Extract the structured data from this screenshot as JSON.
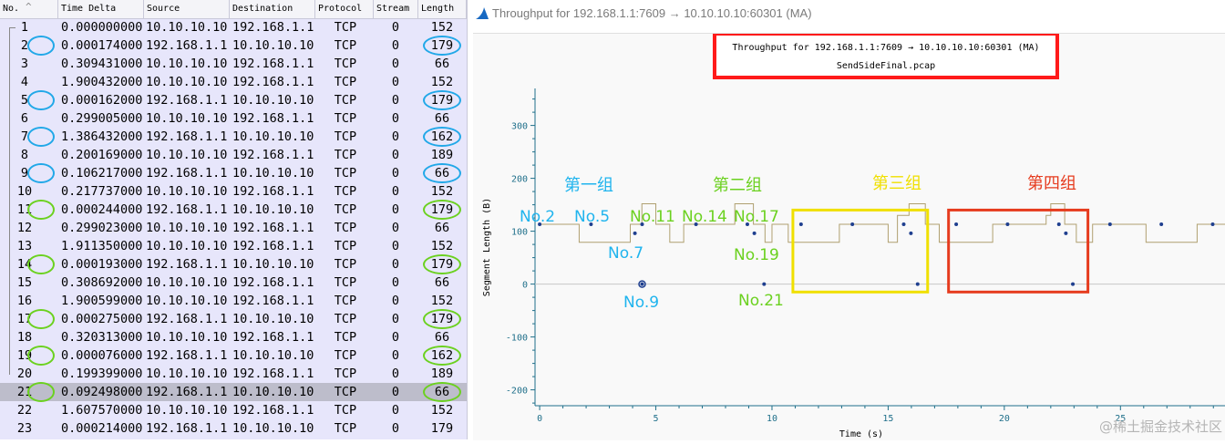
{
  "packet_list": {
    "columns": [
      "No.",
      "Time Delta",
      "Source",
      "Destination",
      "Protocol",
      "Stream",
      "Length"
    ],
    "rows": [
      {
        "no": "1",
        "time_delta": "0.000000000",
        "source": "10.10.10.10",
        "destination": "192.168.1.1",
        "protocol": "TCP",
        "stream": "0",
        "length": "152",
        "mark": ""
      },
      {
        "no": "2",
        "time_delta": "0.000174000",
        "source": "192.168.1.1",
        "destination": "10.10.10.10",
        "protocol": "TCP",
        "stream": "0",
        "length": "179",
        "mark": "blue"
      },
      {
        "no": "3",
        "time_delta": "0.309431000",
        "source": "10.10.10.10",
        "destination": "192.168.1.1",
        "protocol": "TCP",
        "stream": "0",
        "length": "66",
        "mark": ""
      },
      {
        "no": "4",
        "time_delta": "1.900432000",
        "source": "10.10.10.10",
        "destination": "192.168.1.1",
        "protocol": "TCP",
        "stream": "0",
        "length": "152",
        "mark": ""
      },
      {
        "no": "5",
        "time_delta": "0.000162000",
        "source": "192.168.1.1",
        "destination": "10.10.10.10",
        "protocol": "TCP",
        "stream": "0",
        "length": "179",
        "mark": "blue"
      },
      {
        "no": "6",
        "time_delta": "0.299005000",
        "source": "10.10.10.10",
        "destination": "192.168.1.1",
        "protocol": "TCP",
        "stream": "0",
        "length": "66",
        "mark": ""
      },
      {
        "no": "7",
        "time_delta": "1.386432000",
        "source": "192.168.1.1",
        "destination": "10.10.10.10",
        "protocol": "TCP",
        "stream": "0",
        "length": "162",
        "mark": "blue"
      },
      {
        "no": "8",
        "time_delta": "0.200169000",
        "source": "10.10.10.10",
        "destination": "192.168.1.1",
        "protocol": "TCP",
        "stream": "0",
        "length": "189",
        "mark": ""
      },
      {
        "no": "9",
        "time_delta": "0.106217000",
        "source": "192.168.1.1",
        "destination": "10.10.10.10",
        "protocol": "TCP",
        "stream": "0",
        "length": "66",
        "mark": "blue"
      },
      {
        "no": "10",
        "time_delta": "0.217737000",
        "source": "10.10.10.10",
        "destination": "192.168.1.1",
        "protocol": "TCP",
        "stream": "0",
        "length": "152",
        "mark": ""
      },
      {
        "no": "11",
        "time_delta": "0.000244000",
        "source": "192.168.1.1",
        "destination": "10.10.10.10",
        "protocol": "TCP",
        "stream": "0",
        "length": "179",
        "mark": "green"
      },
      {
        "no": "12",
        "time_delta": "0.299023000",
        "source": "10.10.10.10",
        "destination": "192.168.1.1",
        "protocol": "TCP",
        "stream": "0",
        "length": "66",
        "mark": ""
      },
      {
        "no": "13",
        "time_delta": "1.911350000",
        "source": "10.10.10.10",
        "destination": "192.168.1.1",
        "protocol": "TCP",
        "stream": "0",
        "length": "152",
        "mark": ""
      },
      {
        "no": "14",
        "time_delta": "0.000193000",
        "source": "192.168.1.1",
        "destination": "10.10.10.10",
        "protocol": "TCP",
        "stream": "0",
        "length": "179",
        "mark": "green"
      },
      {
        "no": "15",
        "time_delta": "0.308692000",
        "source": "10.10.10.10",
        "destination": "192.168.1.1",
        "protocol": "TCP",
        "stream": "0",
        "length": "66",
        "mark": ""
      },
      {
        "no": "16",
        "time_delta": "1.900599000",
        "source": "10.10.10.10",
        "destination": "192.168.1.1",
        "protocol": "TCP",
        "stream": "0",
        "length": "152",
        "mark": ""
      },
      {
        "no": "17",
        "time_delta": "0.000275000",
        "source": "192.168.1.1",
        "destination": "10.10.10.10",
        "protocol": "TCP",
        "stream": "0",
        "length": "179",
        "mark": "green"
      },
      {
        "no": "18",
        "time_delta": "0.320313000",
        "source": "10.10.10.10",
        "destination": "192.168.1.1",
        "protocol": "TCP",
        "stream": "0",
        "length": "66",
        "mark": ""
      },
      {
        "no": "19",
        "time_delta": "0.000076000",
        "source": "192.168.1.1",
        "destination": "10.10.10.10",
        "protocol": "TCP",
        "stream": "0",
        "length": "162",
        "mark": "green"
      },
      {
        "no": "20",
        "time_delta": "0.199399000",
        "source": "10.10.10.10",
        "destination": "192.168.1.1",
        "protocol": "TCP",
        "stream": "0",
        "length": "189",
        "mark": ""
      },
      {
        "no": "21",
        "time_delta": "0.092498000",
        "source": "192.168.1.1",
        "destination": "10.10.10.10",
        "protocol": "TCP",
        "stream": "0",
        "length": "66",
        "mark": "green",
        "selected": true
      },
      {
        "no": "22",
        "time_delta": "1.607570000",
        "source": "10.10.10.10",
        "destination": "192.168.1.1",
        "protocol": "TCP",
        "stream": "0",
        "length": "152",
        "mark": ""
      },
      {
        "no": "23",
        "time_delta": "0.000214000",
        "source": "192.168.1.1",
        "destination": "10.10.10.10",
        "protocol": "TCP",
        "stream": "0",
        "length": "179",
        "mark": ""
      }
    ]
  },
  "graph_window": {
    "title": "Throughput for 192.168.1.1:7609 → 10.10.10.10:60301 (MA)",
    "icon": "wireshark-fin-icon"
  },
  "chart_data": {
    "type": "scatter",
    "title": "Throughput for 192.168.1.1:7609 → 10.10.10.10:60301 (MA)",
    "subtitle": "SendSideFinal.pcap",
    "xlabel": "Time (s)",
    "ylabel": "Segment Length (B)",
    "xlim": [
      -0.2,
      29.5
    ],
    "ylim": [
      -230,
      370
    ],
    "xticks": [
      0,
      5,
      10,
      15,
      20,
      25
    ],
    "yticks": [
      -200,
      -100,
      0,
      100,
      200,
      300
    ],
    "grid": false,
    "points": [
      {
        "x": 0.0,
        "y": 113
      },
      {
        "x": 2.21,
        "y": 113
      },
      {
        "x": 4.1,
        "y": 96
      },
      {
        "x": 4.41,
        "y": 113
      },
      {
        "x": 4.41,
        "y": 0
      },
      {
        "x": 6.73,
        "y": 113
      },
      {
        "x": 8.94,
        "y": 113
      },
      {
        "x": 9.24,
        "y": 96
      },
      {
        "x": 9.66,
        "y": 0
      },
      {
        "x": 11.25,
        "y": 113
      },
      {
        "x": 13.46,
        "y": 113
      },
      {
        "x": 15.67,
        "y": 113
      },
      {
        "x": 15.98,
        "y": 96
      },
      {
        "x": 16.27,
        "y": 0
      },
      {
        "x": 17.93,
        "y": 113
      },
      {
        "x": 20.14,
        "y": 113
      },
      {
        "x": 22.35,
        "y": 113
      },
      {
        "x": 22.65,
        "y": 96
      },
      {
        "x": 22.95,
        "y": 0
      },
      {
        "x": 24.55,
        "y": 113
      },
      {
        "x": 26.76,
        "y": 113
      },
      {
        "x": 28.97,
        "y": 113
      }
    ],
    "ma_series_name": "MA",
    "ma_x": [
      0,
      1.7,
      1.7,
      3.9,
      3.9,
      4.4,
      4.4,
      5.0,
      5.0,
      5.6,
      5.6,
      6.2,
      6.2,
      8.4,
      8.4,
      9.2,
      9.2,
      9.7,
      9.7,
      10.0,
      10.0,
      10.7,
      10.7,
      12.9,
      12.9,
      15.0,
      15.0,
      15.4,
      15.4,
      15.9,
      15.9,
      16.6,
      16.6,
      17.2,
      17.2,
      19.5,
      19.5,
      21.8,
      21.8,
      22.0,
      22.0,
      22.6,
      22.6,
      23.1,
      23.1,
      23.8,
      23.8,
      26.1,
      26.1,
      28.3,
      28.3,
      29.5
    ],
    "ma_y": [
      113,
      113,
      79,
      79,
      113,
      113,
      152,
      152,
      113,
      113,
      79,
      79,
      113,
      113,
      152,
      152,
      113,
      113,
      79,
      79,
      113,
      113,
      79,
      79,
      113,
      113,
      79,
      79,
      130,
      130,
      152,
      152,
      113,
      113,
      79,
      79,
      113,
      113,
      130,
      130,
      152,
      152,
      113,
      113,
      79,
      79,
      113,
      113,
      79,
      79,
      113,
      113
    ],
    "annotations": {
      "groups": [
        {
          "label": "第一组",
          "color": "#1fb4ee"
        },
        {
          "label": "第二组",
          "color": "#6bd11f"
        },
        {
          "label": "第三组",
          "color": "#f0e000"
        },
        {
          "label": "第四组",
          "color": "#e63b1e"
        }
      ],
      "packet_labels": [
        {
          "label": "No.2",
          "color": "#1fb4ee"
        },
        {
          "label": "No.5",
          "color": "#1fb4ee"
        },
        {
          "label": "No.7",
          "color": "#1fb4ee"
        },
        {
          "label": "No.9",
          "color": "#1fb4ee"
        },
        {
          "label": "No.11",
          "color": "#6bd11f"
        },
        {
          "label": "No.14",
          "color": "#6bd11f"
        },
        {
          "label": "No.17",
          "color": "#6bd11f"
        },
        {
          "label": "No.19",
          "color": "#6bd11f"
        },
        {
          "label": "No.21",
          "color": "#6bd11f"
        }
      ]
    }
  },
  "watermark": "@稀土掘金技术社区",
  "colors": {
    "list_bg": "#e7e6fb",
    "selected_row": "#bdbdcb",
    "title_box": "#ff1a1a",
    "axis": "#1f6f8a",
    "dots": "#1f3f8f",
    "ma_line": "#b0a070"
  }
}
